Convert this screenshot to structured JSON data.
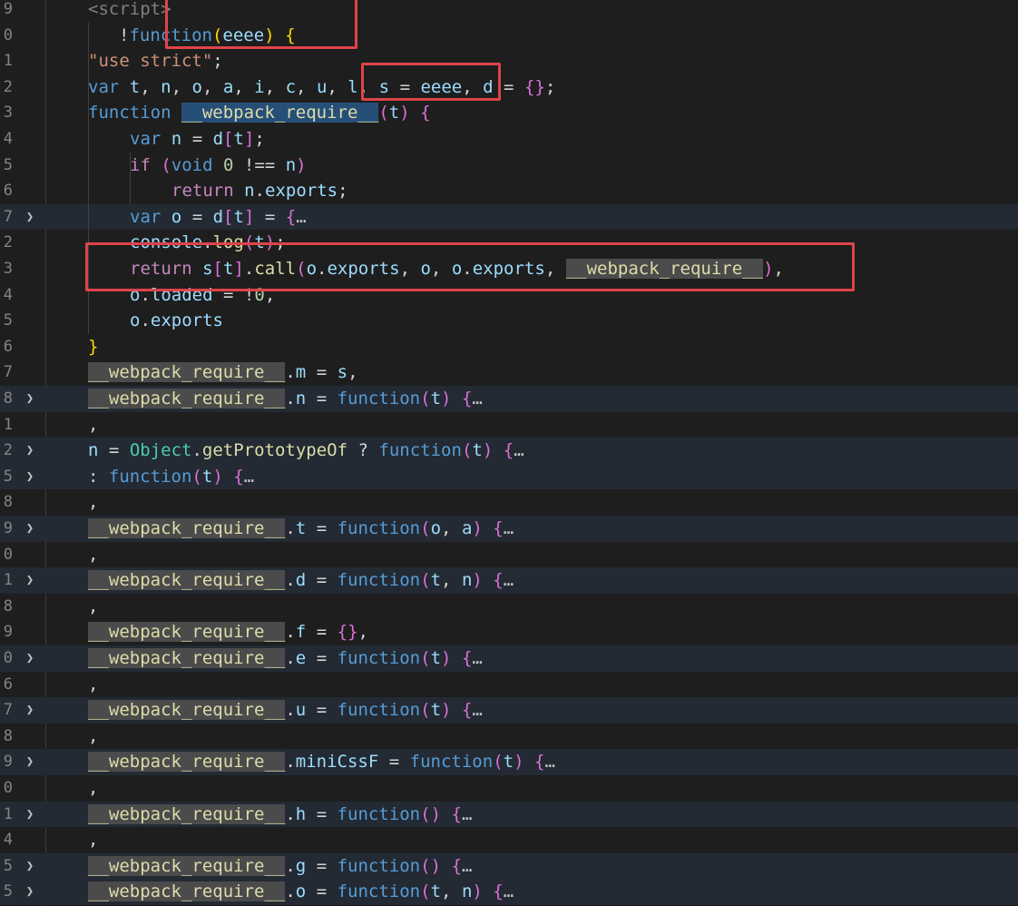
{
  "editor": {
    "rows": [
      {
        "ln": "9",
        "chev": "",
        "t": "<script>"
      },
      {
        "ln": "0",
        "chev": "",
        "t": "!function(eeee) {"
      },
      {
        "ln": "1",
        "chev": "",
        "t": "\"use strict\";"
      },
      {
        "ln": "2",
        "chev": "",
        "t": "var t, n, o, a, i, c, u, l, s = eeee, d = {};"
      },
      {
        "ln": "3",
        "chev": "",
        "t": "function __webpack_require__(t) {"
      },
      {
        "ln": "4",
        "chev": "",
        "t": "var n = d[t];"
      },
      {
        "ln": "5",
        "chev": "",
        "t": "if (void 0 !== n)"
      },
      {
        "ln": "6",
        "chev": "",
        "t": "return n.exports;"
      },
      {
        "ln": "7",
        "chev": ">",
        "t": "var o = d[t] = {…"
      },
      {
        "ln": "2",
        "chev": "",
        "t": "console.log(t);"
      },
      {
        "ln": "3",
        "chev": "",
        "t": "return s[t].call(o.exports, o, o.exports, __webpack_require__),"
      },
      {
        "ln": "4",
        "chev": "",
        "t": "o.loaded = !0,"
      },
      {
        "ln": "5",
        "chev": "",
        "t": "o.exports"
      },
      {
        "ln": "6",
        "chev": "",
        "t": "}"
      },
      {
        "ln": "7",
        "chev": "",
        "t": "__webpack_require__.m = s,"
      },
      {
        "ln": "8",
        "chev": ">",
        "t": "__webpack_require__.n = function(t) {…"
      },
      {
        "ln": "1",
        "chev": "",
        "t": ","
      },
      {
        "ln": "2",
        "chev": ">",
        "t": "n = Object.getPrototypeOf ? function(t) {…"
      },
      {
        "ln": "5",
        "chev": ">",
        "t": ": function(t) {…"
      },
      {
        "ln": "8",
        "chev": "",
        "t": ","
      },
      {
        "ln": "9",
        "chev": ">",
        "t": "__webpack_require__.t = function(o, a) {…"
      },
      {
        "ln": "0",
        "chev": "",
        "t": ","
      },
      {
        "ln": "1",
        "chev": ">",
        "t": "__webpack_require__.d = function(t, n) {…"
      },
      {
        "ln": "8",
        "chev": "",
        "t": ","
      },
      {
        "ln": "9",
        "chev": "",
        "t": "__webpack_require__.f = {},"
      },
      {
        "ln": "0",
        "chev": ">",
        "t": "__webpack_require__.e = function(t) {…"
      },
      {
        "ln": "6",
        "chev": "",
        "t": ","
      },
      {
        "ln": "7",
        "chev": ">",
        "t": "__webpack_require__.u = function(t) {…"
      },
      {
        "ln": "8",
        "chev": "",
        "t": ","
      },
      {
        "ln": "9",
        "chev": ">",
        "t": "__webpack_require__.miniCssF = function(t) {…"
      },
      {
        "ln": "0",
        "chev": "",
        "t": ","
      },
      {
        "ln": "1",
        "chev": ">",
        "t": "__webpack_require__.h = function() {…"
      },
      {
        "ln": "4",
        "chev": "",
        "t": ","
      },
      {
        "ln": "5",
        "chev": ">",
        "t": "__webpack_require__.g = function() {…"
      },
      {
        "ln": "5",
        "chev": ">",
        "t": "__webpack_require__.o = function(t, n) {…"
      }
    ]
  },
  "colors": {
    "background": "#1e1e1e",
    "keyword": "#569cd6",
    "control": "#c586c0",
    "string": "#ce9178",
    "variable": "#9cdcfe",
    "function": "#dcdcaa",
    "class": "#4ec9b0",
    "number": "#b5cea8",
    "annotation_box": "#e0434a"
  },
  "icons": {
    "fold": "chevron-right-icon",
    "folded_placeholder": "ellipsis-icon"
  }
}
